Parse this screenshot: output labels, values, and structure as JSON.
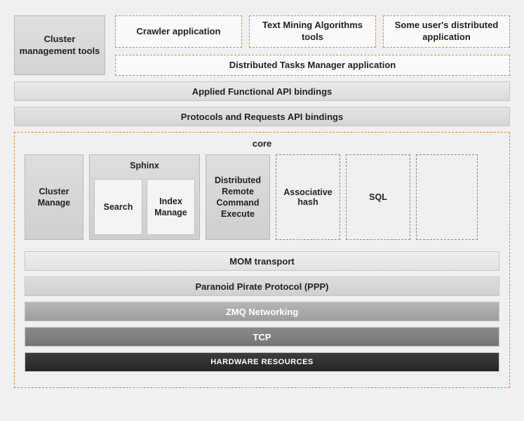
{
  "top": {
    "cluster_mgmt": "Cluster management tools",
    "apps": {
      "crawler": "Crawler application",
      "text_mining": "Text Mining Algorithms tools",
      "user_dist": "Some user's distributed application"
    },
    "dtm": "Distributed Tasks Manager application"
  },
  "bindings": {
    "functional": "Applied Functional API bindings",
    "protocols": "Protocols and Requests API bindings"
  },
  "core": {
    "label": "core",
    "cluster_manage": "Cluster Manage",
    "sphinx": {
      "label": "Sphinx",
      "search": "Search",
      "index_manage": "Index Manage"
    },
    "drce": "Distributed Remote Command Execute",
    "assoc_hash": "Associative hash",
    "sql": "SQL",
    "empty": ""
  },
  "stack": {
    "mom": "MOM transport",
    "ppp": "Paranoid Pirate Protocol (PPP)",
    "zmq": "ZMQ Networking",
    "tcp": "TCP",
    "hw": "HARDWARE RESOURCES"
  }
}
